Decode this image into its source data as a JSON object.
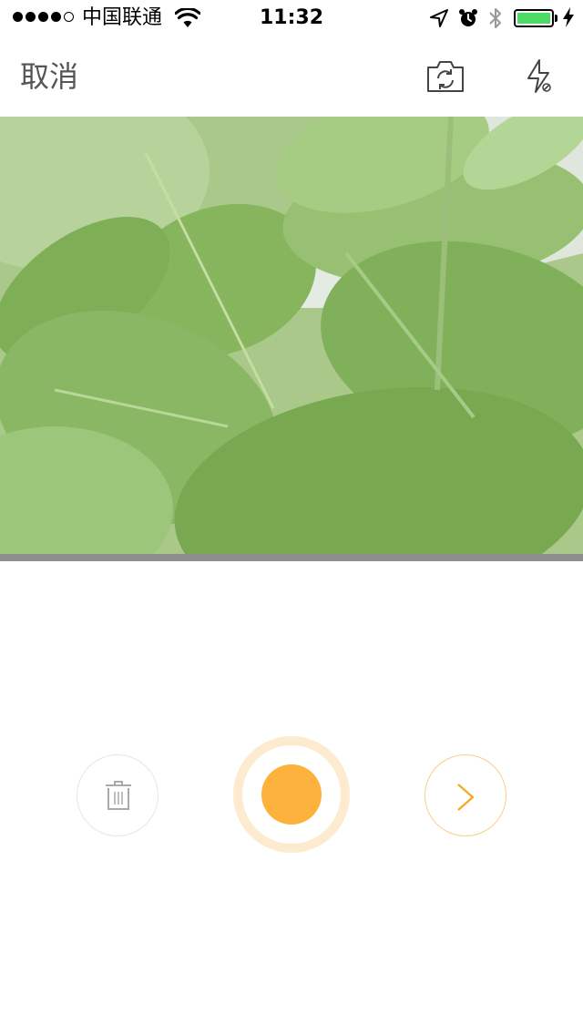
{
  "status_bar": {
    "carrier": "中国联通",
    "time": "11:32",
    "signal_bars_filled": 4,
    "signal_bars_total": 5,
    "battery_level": 1.0,
    "battery_color": "#4cd964",
    "icons": [
      "signal-dots-icon",
      "wifi-icon",
      "location-arrow-icon",
      "alarm-icon",
      "bluetooth-icon",
      "battery-icon",
      "charging-bolt-icon"
    ]
  },
  "nav": {
    "cancel_label": "取消",
    "icons": [
      "camera-switch-icon",
      "flash-icon"
    ]
  },
  "controls": {
    "icons": [
      "trash-icon",
      "record-icon",
      "chevron-right-icon"
    ],
    "accent_color": "#fcb23d",
    "ring_color": "#fdebcf"
  }
}
